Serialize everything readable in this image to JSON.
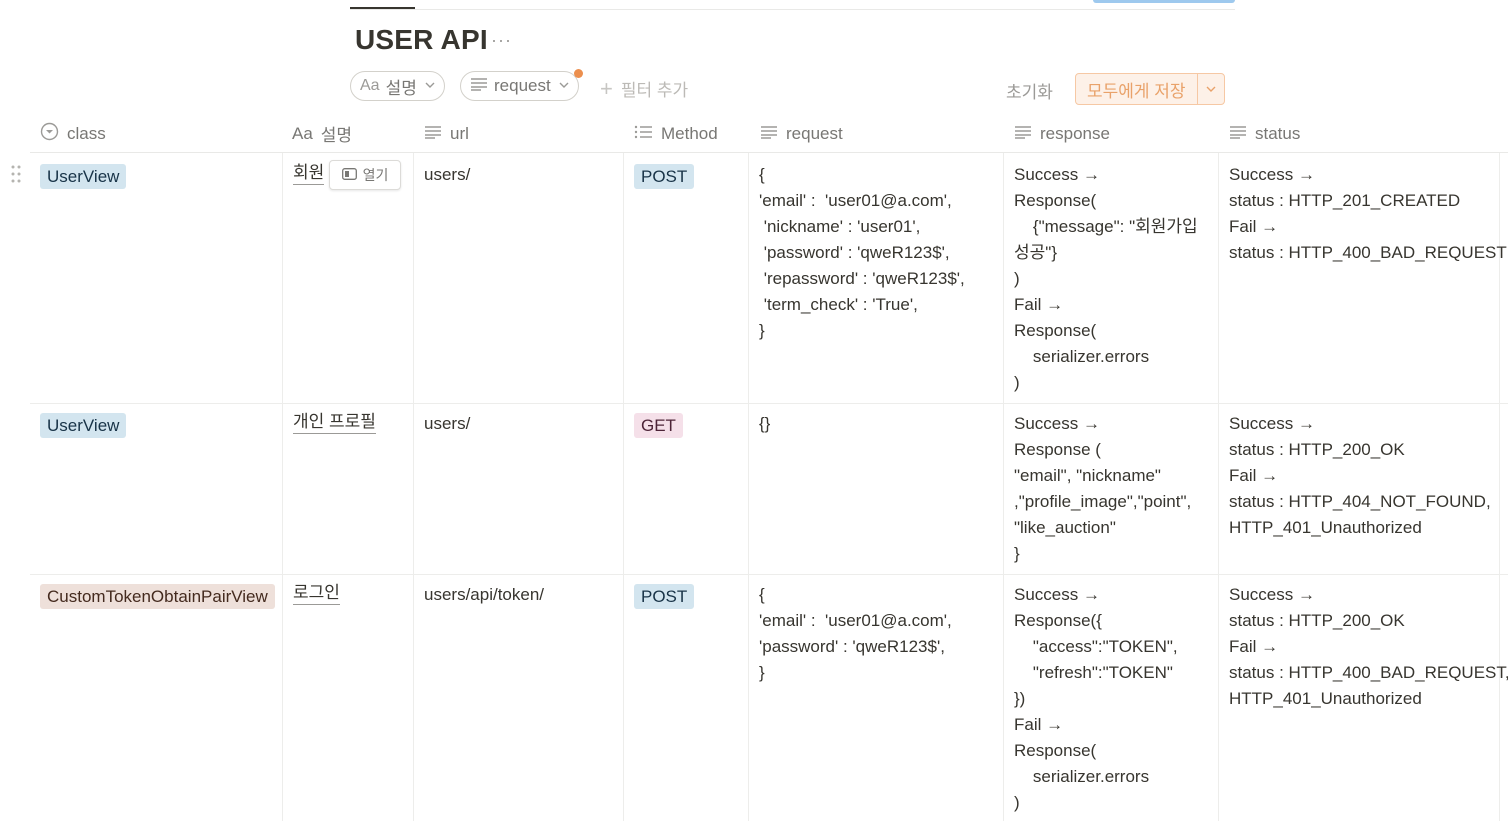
{
  "page": {
    "title": "USER API",
    "more": "···"
  },
  "toolbar": {
    "chip_sort_label": "설명",
    "chip_sort_prefix": "Aa",
    "chip_request_label": "request",
    "add_filter_label": "필터 추가",
    "reset_label": "초기화",
    "save_label": "모두에게 저장"
  },
  "columns": [
    {
      "label": "class",
      "icon": "select-icon"
    },
    {
      "label": "설명",
      "prefix": "Aa",
      "icon": "title-icon"
    },
    {
      "label": "url",
      "icon": "text-icon"
    },
    {
      "label": "Method",
      "icon": "list-icon"
    },
    {
      "label": "request",
      "icon": "text-icon"
    },
    {
      "label": "response",
      "icon": "text-icon"
    },
    {
      "label": "status",
      "icon": "text-icon"
    }
  ],
  "rows": [
    {
      "class": "UserView",
      "class_color": "blue",
      "title": "회원",
      "open_label": "열기",
      "url": "users/",
      "method": "POST",
      "method_color": "blue",
      "request": "{\n'email' :  'user01@a.com',\n 'nickname' : 'user01',\n 'password' : 'qweR123$',\n 'repassword' : 'qweR123$',\n 'term_check' : 'True',\n}",
      "response": "Success →\nResponse(\n    {\"message\": \"회원가입\n성공\"}\n)\nFail →\nResponse(\n    serializer.errors\n)",
      "status": "Success →\nstatus : HTTP_201_CREATED\nFail →\nstatus : HTTP_400_BAD_REQUEST"
    },
    {
      "class": "UserView",
      "class_color": "blue",
      "title": "개인 프로필",
      "url": "users/",
      "method": "GET",
      "method_color": "pink",
      "request": "{}",
      "response": "Success →\nResponse (\n\"email\", \"nickname\"\n,\"profile_image\",\"point\",\n\"like_auction\"\n}",
      "status": "Success →\nstatus : HTTP_200_OK\nFail →\nstatus : HTTP_404_NOT_FOUND,\nHTTP_401_Unauthorized"
    },
    {
      "class": "CustomTokenObtainPairView",
      "class_color": "brown",
      "title": "로그인",
      "url": "users/api/token/",
      "method": "POST",
      "method_color": "blue",
      "request": "{\n'email' :  'user01@a.com',\n'password' : 'qweR123$',\n}",
      "response": "Success →\nResponse({\n    \"access\":\"TOKEN\",\n    \"refresh\":\"TOKEN\"\n})\nFail →\nResponse(\n    serializer.errors\n)",
      "status": "Success →\nstatus : HTTP_200_OK\nFail →\nstatus : HTTP_400_BAD_REQUEST,\nHTTP_401_Unauthorized"
    }
  ],
  "colors": {
    "tag_blue": "#d3e5ef",
    "tag_pink": "#f5e0e9",
    "tag_brown": "#eee0da",
    "accent_orange": "#ec8f4e"
  }
}
